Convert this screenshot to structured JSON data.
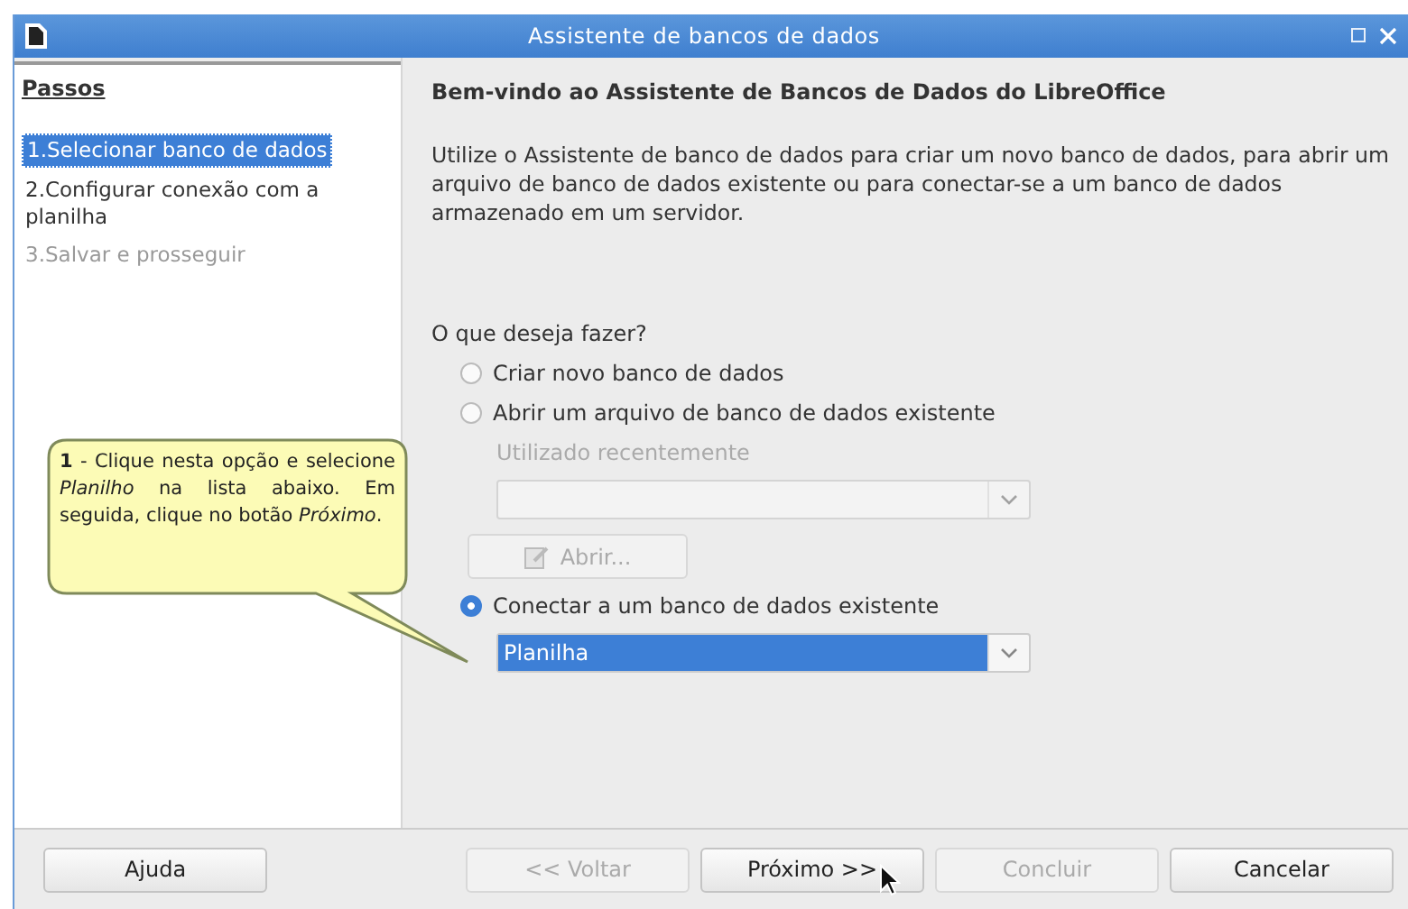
{
  "window": {
    "title": "Assistente de bancos de dados"
  },
  "steps": {
    "title": "Passos",
    "items": [
      {
        "label": "1.Selecionar banco de dados",
        "selected": true,
        "disabled": false
      },
      {
        "label": "2.Configurar conexão com a planilha",
        "selected": false,
        "disabled": false
      },
      {
        "label": "3.Salvar e prosseguir",
        "selected": false,
        "disabled": true
      }
    ]
  },
  "content": {
    "heading": "Bem-vindo ao Assistente de Bancos de Dados do LibreOffice",
    "intro": "Utilize o Assistente de banco de dados para criar um novo banco de dados, para abrir um arquivo de banco de dados existente ou para conectar-se a um banco de dados armazenado em um servidor.",
    "question": "O que deseja fazer?",
    "options": [
      {
        "kind": "radio",
        "label": "Criar novo banco de dados",
        "selected": false
      },
      {
        "kind": "radio",
        "label": "Abrir um arquivo de banco de dados existente",
        "selected": false
      },
      {
        "kind": "label",
        "label": "Utilizado recentemente",
        "disabled": true
      },
      {
        "kind": "combo",
        "disabled": true
      },
      {
        "kind": "button",
        "label": "Abrir...",
        "disabled": true
      },
      {
        "kind": "radio",
        "label": "Conectar a um banco de dados existente",
        "selected": true
      },
      {
        "kind": "combo",
        "value": "Planilha",
        "disabled": false
      }
    ]
  },
  "callout": {
    "text": "**1** - Clique nesta opção e selecione *Planilho* na lista abaixo. Em seguida, clique no botão *Próximo*."
  },
  "buttons": [
    {
      "label": "Ajuda",
      "disabled": false
    },
    {
      "label": "<< Voltar",
      "disabled": true
    },
    {
      "label": "Próximo >>",
      "disabled": false
    },
    {
      "label": "Concluir",
      "disabled": true
    },
    {
      "label": "Cancelar",
      "disabled": false
    }
  ]
}
